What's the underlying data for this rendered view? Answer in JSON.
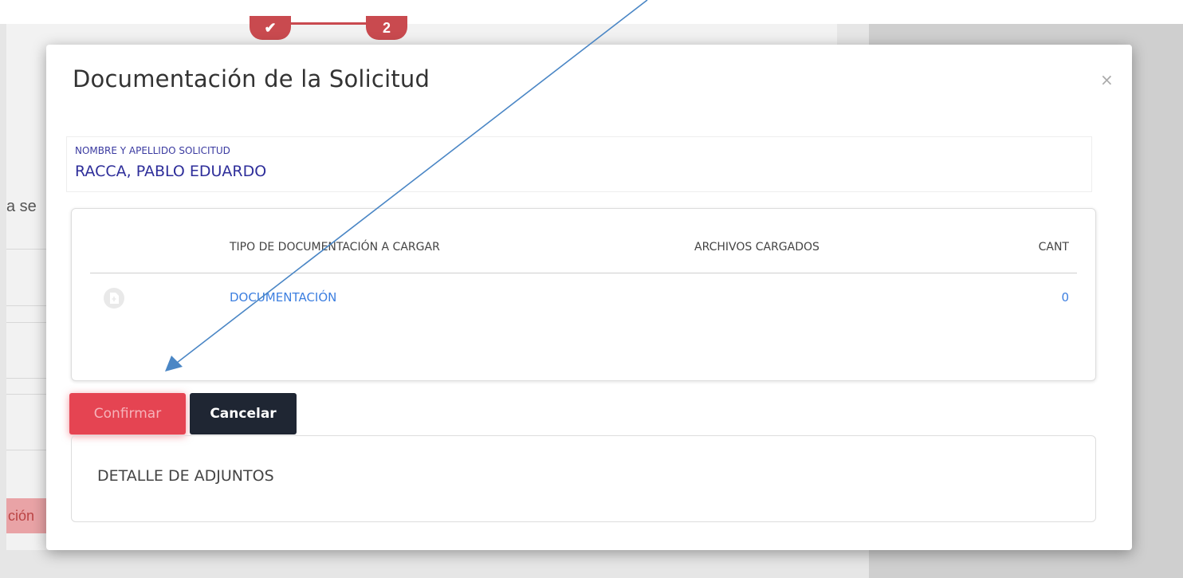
{
  "modal": {
    "title": "Documentación de la Solicitud",
    "close_label": "×",
    "applicant": {
      "label": "NOMBRE Y APELLIDO SOLICITUD",
      "name": "RACCA, PABLO EDUARDO"
    },
    "table": {
      "headers": {
        "tipo": "TIPO DE DOCUMENTACIÓN A CARGAR",
        "archivos": "ARCHIVOS CARGADOS",
        "cant": "CANT"
      },
      "rows": [
        {
          "icon": "upload-file-icon",
          "tipo": "DOCUMENTACIÓN",
          "archivos": "",
          "cant": "0"
        }
      ]
    },
    "buttons": {
      "confirm": "Confirmar",
      "cancel": "Cancelar"
    },
    "attachments": {
      "title": "DETALLE DE ADJUNTOS"
    }
  },
  "background": {
    "stepper": {
      "step1": "✔",
      "step2": "2"
    },
    "partial_text": "a se",
    "partial_button": "ción"
  },
  "colors": {
    "confirm_bg": "#e54452",
    "cancel_bg": "#1f2633",
    "link": "#3d7fe0",
    "applicant_text": "#2e2e9a",
    "annotation_arrow": "#4a86c5"
  }
}
